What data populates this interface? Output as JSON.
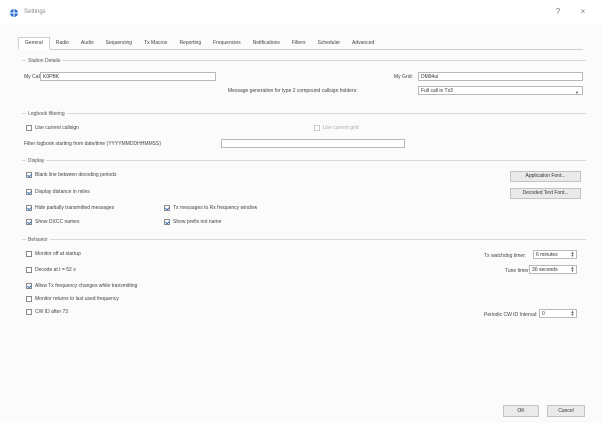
{
  "window": {
    "title": "Settings",
    "help": "?",
    "close": "×"
  },
  "tabs": [
    "General",
    "Radio",
    "Audio",
    "Sequencing",
    "Tx Macros",
    "Reporting",
    "Frequencies",
    "Notifications",
    "Filters",
    "Scheduler",
    "Advanced"
  ],
  "station": {
    "group": "Station Details",
    "my_call_label": "My Call:",
    "my_call_value": "K0PBK",
    "my_grid_label": "My Grid:",
    "my_grid_value": "DM94ui",
    "msg_gen_label": "Message generation for type 2 compound callsign holders:",
    "msg_gen_value": "Full call in Tx3"
  },
  "logbook": {
    "group": "Logbook filtering",
    "use_current_callsign": "Use current callsign",
    "use_current_grid": "Use current grid",
    "filter_label": "Filter logbook starting from date/time (YYYYMMDDHHMMSS)",
    "filter_value": ""
  },
  "display": {
    "group": "Display",
    "blank_line": "Blank line between decoding periods",
    "distance": "Display distance in miles",
    "hide_partial": "Hide partially transmitted messages",
    "tx_messages": "Tx messages to Rx frequency window",
    "show_dxcc": "Show DXCC names",
    "show_prefix": "Show prefix not name",
    "app_font_btn": "Application Font...",
    "decoded_font_btn": "Decoded Text Font..."
  },
  "behavior": {
    "group": "Behavior",
    "monitor_off": "Monitor off at startup",
    "decode_at": "Decode at t = 52 s",
    "allow_tx": "Allow Tx frequency changes while transmitting",
    "monitor_returns": "Monitor returns to last used frequency",
    "cw_id": "CW ID after 73",
    "watchdog_label": "Tx watchdog timer:",
    "watchdog_value": "6 minutes",
    "tune_label": "Tune timer:",
    "tune_value": "30 seconds",
    "cw_interval_label": "Periodic CW ID Interval:",
    "cw_interval_value": "0"
  },
  "footer": {
    "ok": "OK",
    "cancel": "Cancel"
  },
  "colors": {
    "accent": "#3a6fb5",
    "background": "#fbfbfb"
  }
}
